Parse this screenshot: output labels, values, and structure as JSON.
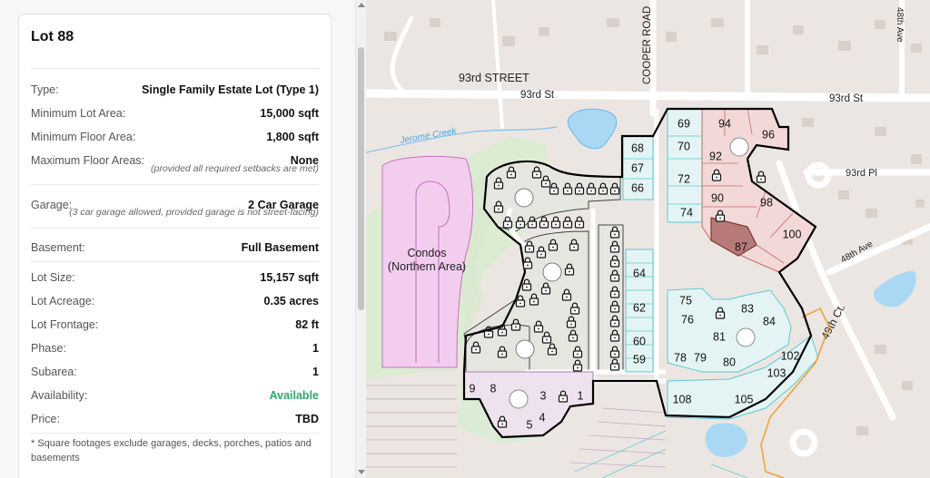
{
  "lot": {
    "title": "Lot 88",
    "type_label": "Type:",
    "type_value": "Single Family Estate Lot (Type 1)",
    "min_lot_area_label": "Minimum Lot Area:",
    "min_lot_area_value": "15,000 sqft",
    "min_floor_area_label": "Minimum Floor Area:",
    "min_floor_area_value": "1,800 sqft",
    "max_floor_areas_label": "Maximum Floor Areas:",
    "max_floor_areas_value": "None",
    "max_floor_note": "(provided all required setbacks are met)",
    "garage_label": "Garage:",
    "garage_value": "2 Car Garage",
    "garage_note": "(3 car garage allowed, provided garage is not street-facing)",
    "basement_label": "Basement:",
    "basement_value": "Full Basement",
    "lot_size_label": "Lot Size:",
    "lot_size_value": "15,157 sqft",
    "lot_acreage_label": "Lot Acreage:",
    "lot_acreage_value": "0.35 acres",
    "lot_frontage_label": "Lot Frontage:",
    "lot_frontage_value": "82 ft",
    "phase_label": "Phase:",
    "phase_value": "1",
    "subarea_label": "Subarea:",
    "subarea_value": "1",
    "availability_label": "Availability:",
    "availability_value": "Available",
    "price_label": "Price:",
    "price_value": "TBD",
    "footnote": "* Square footages exclude garages, decks, porches, patios and basements",
    "availability_color": "#2eaa6b"
  },
  "map": {
    "street_labels": {
      "s93_street": "93rd STREET",
      "s93_st_left": "93rd St",
      "s93_st_right": "93rd St",
      "cooper_road": "COOPER ROAD",
      "s93_pl": "93rd Pl",
      "ave48": "48th Ave",
      "ave48_top": "48th Ave",
      "ct49": "49th Ct.",
      "jerome_creek": "Jerome Creek"
    },
    "area_labels": {
      "condos_line1": "Condos",
      "condos_line2": "(Northern Area)"
    },
    "lock_icon_name": "lock-icon",
    "colors": {
      "lot_cyan": "#5cc8d2",
      "lot_red": "#c66a6a",
      "lot_red_fill": "#f2d9d7",
      "lot_selected_fill": "#b87a78",
      "lot_purple": "#b27ab2",
      "lot_gray": "#6b6b6b",
      "boundary": "#000000",
      "water": "#a9d8f5",
      "park": "#d7ecd0",
      "condos_fill": "#f2c9f0",
      "orange_line": "#f0a030"
    },
    "lots_cyan": [
      {
        "n": "68"
      },
      {
        "n": "67"
      },
      {
        "n": "66"
      },
      {
        "n": "69"
      },
      {
        "n": "70"
      },
      {
        "n": "72"
      },
      {
        "n": "74"
      },
      {
        "n": "64"
      },
      {
        "n": "62"
      },
      {
        "n": "60"
      },
      {
        "n": "59"
      },
      {
        "n": "75"
      },
      {
        "n": "76"
      },
      {
        "n": "83"
      },
      {
        "n": "84"
      },
      {
        "n": "81"
      },
      {
        "n": "78"
      },
      {
        "n": "79"
      },
      {
        "n": "80"
      },
      {
        "n": "102"
      },
      {
        "n": "103"
      },
      {
        "n": "108"
      },
      {
        "n": "105"
      }
    ],
    "lots_red": [
      {
        "n": "94"
      },
      {
        "n": "96"
      },
      {
        "n": "92"
      },
      {
        "n": "90"
      },
      {
        "n": "98"
      },
      {
        "n": "87"
      },
      {
        "n": "100"
      }
    ],
    "lots_purple": [
      {
        "n": "9"
      },
      {
        "n": "8"
      },
      {
        "n": "3"
      },
      {
        "n": "1"
      },
      {
        "n": "5"
      },
      {
        "n": "4"
      }
    ]
  }
}
